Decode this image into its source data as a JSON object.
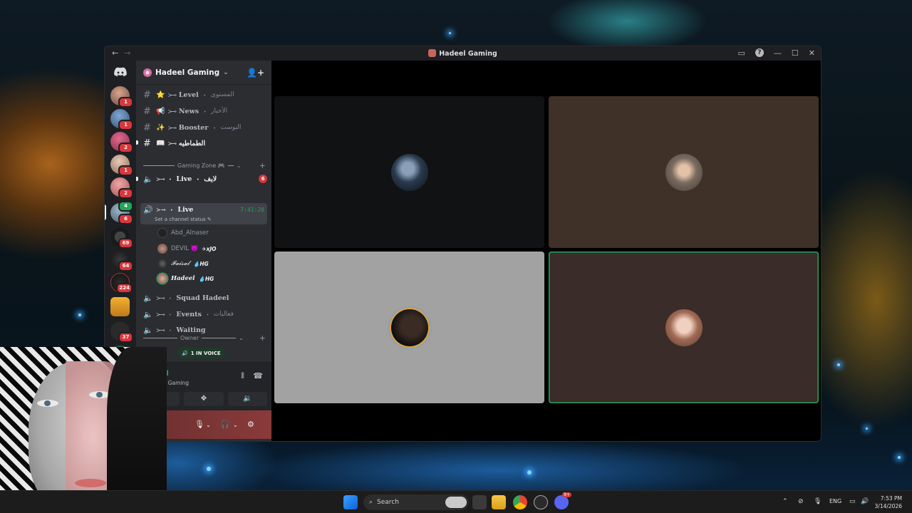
{
  "window": {
    "title": "Hadeel Gaming",
    "back_icon": "arrow-left-icon",
    "forward_icon": "arrow-right-icon",
    "controls": [
      "inbox-icon",
      "help-icon",
      "minimize-icon",
      "maximize-icon",
      "close-icon"
    ]
  },
  "rail": {
    "servers": [
      {
        "badge": "1"
      },
      {
        "badge": "1"
      },
      {
        "badge": "2"
      },
      {
        "badge": "1"
      },
      {
        "badge": "2"
      },
      {
        "badge": "6",
        "top_badge": "4"
      },
      {
        "badge": "69"
      },
      {
        "badge": "64"
      },
      {
        "badge": "224"
      },
      {
        "badge": ""
      },
      {
        "badge": "37"
      }
    ]
  },
  "server": {
    "name": "Hadeel Gaming",
    "channels": [
      {
        "emoji": "⭐",
        "name": "Level",
        "arabic": "المستوى"
      },
      {
        "emoji": "📢",
        "name": "News",
        "arabic": "الأخبار"
      },
      {
        "emoji": "✨",
        "name": "Booster",
        "arabic": "البوست"
      },
      {
        "emoji": "📖",
        "name": "",
        "arabic": "الطماطيه"
      }
    ],
    "category_gaming": "Gaming Zone 🎮",
    "voice_live_1": {
      "name": "Live",
      "arabic": "لايف",
      "count": "6"
    },
    "voice_live_2": {
      "name": "Live",
      "timer": "7:41:20",
      "status": "Set a channel status"
    },
    "members": [
      {
        "name": "Abd_Alnaser",
        "tag": ""
      },
      {
        "name": "DEVIL 👿",
        "tag": "✈xJO"
      },
      {
        "name": "𝓕𝓪𝓲𝓼𝓪𝓵",
        "tag": "💧HG"
      },
      {
        "name": "𝑯𝒂𝒅𝒆𝒆𝒍",
        "tag": "💧HG"
      }
    ],
    "voice_channels": [
      {
        "name": "Squad Hadeel",
        "arabic": ""
      },
      {
        "name": "Events",
        "arabic": "فعاليات"
      },
      {
        "name": "Waiting",
        "arabic": ""
      }
    ],
    "category_owner": "Owner",
    "in_voice": "1 IN VOICE"
  },
  "voice_panel": {
    "status": "ected",
    "server": "Hadeel Gaming"
  },
  "taskbar": {
    "search_placeholder": "Search",
    "lang": "ENG",
    "time": "7:53 PM",
    "date": "3/14/2026",
    "discord_badge": "9+"
  },
  "colors": {
    "accent_green": "#23a55a",
    "badge_red": "#da373c",
    "tile_1": "#111214",
    "tile_2": "#3f3128",
    "tile_3": "#a2a2a2",
    "tile_4": "#3a2c28"
  }
}
